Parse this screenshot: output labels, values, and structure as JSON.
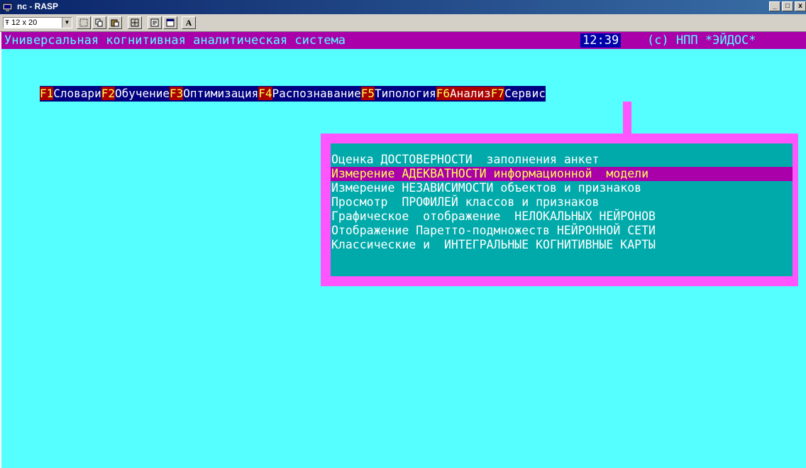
{
  "window": {
    "title": "nc - RASP",
    "buttons": [
      "_",
      "□",
      "x"
    ]
  },
  "toolbar": {
    "font_size": "12 x 20",
    "text_button": "A"
  },
  "status": {
    "title": "Универсальная когнитивная аналитическая система",
    "time": "12:39",
    "copyright": "(c) НПП *ЭЙДОС*"
  },
  "menu": {
    "items": [
      {
        "key": "F1",
        "label": "Словари"
      },
      {
        "key": "F2",
        "label": "Обучение"
      },
      {
        "key": "F3",
        "label": "Оптимизация"
      },
      {
        "key": "F4",
        "label": "Распознавание"
      },
      {
        "key": "F5",
        "label": "Типология"
      },
      {
        "key": "F6",
        "label": "Анализ"
      },
      {
        "key": "F7",
        "label": "Сервис"
      }
    ],
    "selected_index": 5
  },
  "submenu": {
    "items": [
      "Оценка ДОСТОВЕРНОСТИ  заполнения анкет",
      "Измерение АДЕКВАТНОСТИ информационной  модели",
      "Измерение НЕЗАВИСИМОСТИ объектов и признаков",
      "Просмотр  ПРОФИЛЕЙ классов и признаков",
      "Графическое  отображение  НЕЛОКАЛЬНЫХ НЕЙРОНОВ",
      "Отображение Паретто-подмножеств НЕЙРОННОЙ СЕТИ",
      "Классические и  ИНТЕГРАЛЬНЫЕ КОГНИТИВНЫЕ КАРТЫ"
    ],
    "active_index": 1
  },
  "colors": {
    "background": "#55ffff",
    "status_bar": "#aa00aa",
    "menu_bar": "#000080",
    "hotkey": "#aa0000",
    "popup": "#00aaaa",
    "popup_frame": "#ff55ff"
  }
}
